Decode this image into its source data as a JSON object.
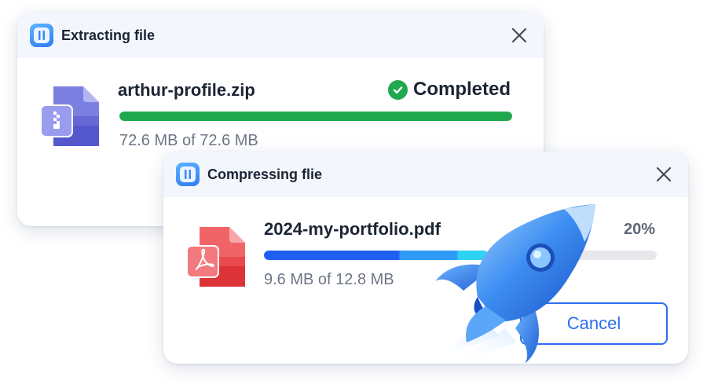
{
  "extract_dialog": {
    "title": "Extracting file",
    "file_name": "arthur-profile.zip",
    "status": "Completed",
    "size_text": "72.6 MB of 72.6 MB",
    "progress": 1.0,
    "progress_color": "#1fa84e"
  },
  "compress_dialog": {
    "title": "Compressing flie",
    "file_name": "2024-my-portfolio.pdf",
    "percent_text": "20%",
    "size_text": "9.6 MB of 12.8 MB",
    "cancel_label": "Cancel",
    "accent_color": "#2d6df0"
  },
  "icons": {
    "app": "app-icon",
    "close": "close-icon",
    "zip_file": "zip-file-icon",
    "pdf_file": "pdf-file-icon",
    "completed": "check-circle-icon",
    "rocket": "rocket-illustration"
  }
}
